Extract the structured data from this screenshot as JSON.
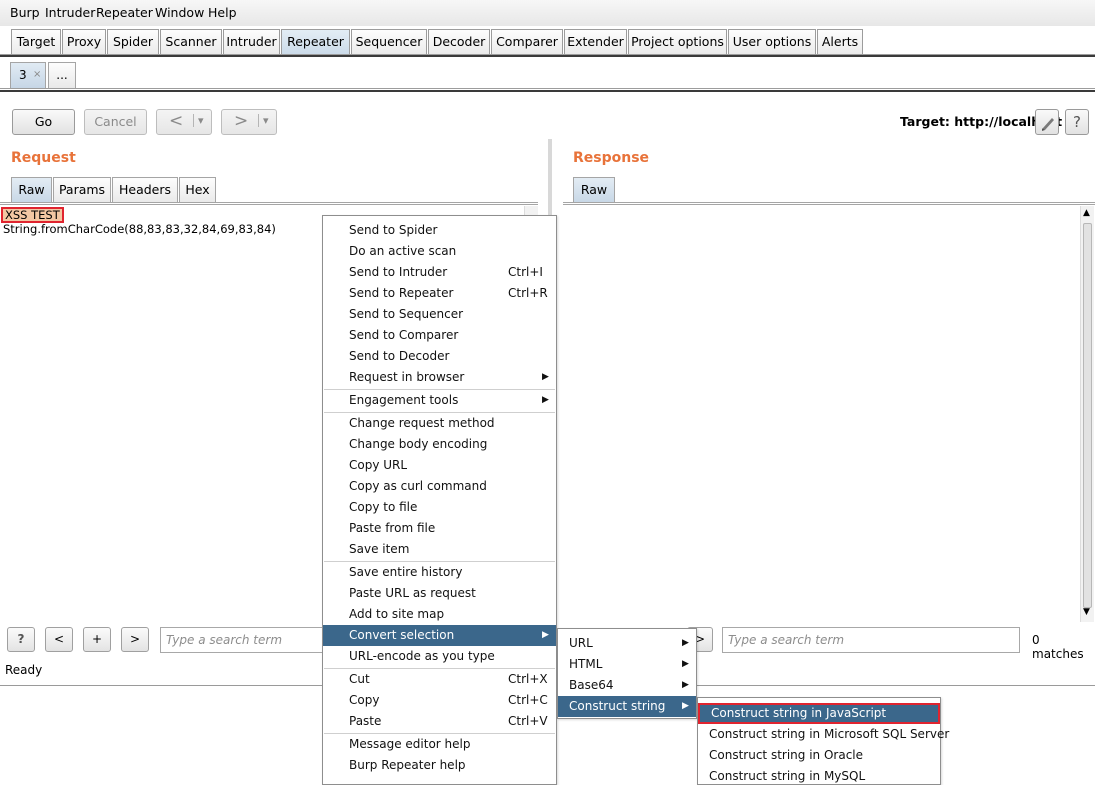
{
  "menubar": [
    "Burp",
    "Intruder",
    "Repeater",
    "Window",
    "Help"
  ],
  "tabs": [
    "Target",
    "Proxy",
    "Spider",
    "Scanner",
    "Intruder",
    "Repeater",
    "Sequencer",
    "Decoder",
    "Comparer",
    "Extender",
    "Project options",
    "User options",
    "Alerts"
  ],
  "active_tab": "Repeater",
  "subtabs": [
    "3",
    "..."
  ],
  "subtab_close": "×",
  "toolbar": {
    "go": "Go",
    "cancel": "Cancel",
    "back": "<",
    "forward": ">",
    "dropdown": "▾",
    "target_label": "Target: http://localhost"
  },
  "request": {
    "title": "Request",
    "tabs": [
      "Raw",
      "Params",
      "Headers",
      "Hex"
    ],
    "lines": [
      "XSS TEST",
      "String.fromCharCode(88,83,83,32,84,69,83,84)"
    ]
  },
  "response": {
    "title": "Response",
    "tabs": [
      "Raw"
    ]
  },
  "bottom": {
    "help": "?",
    "prev": "<",
    "add": "+",
    "next": ">",
    "search_placeholder": "Type a search term",
    "matches": "0 matches"
  },
  "status": "Ready",
  "context_menu": {
    "groups": [
      [
        {
          "label": "Send to Spider"
        },
        {
          "label": "Do an active scan"
        },
        {
          "label": "Send to Intruder",
          "shortcut": "Ctrl+I"
        },
        {
          "label": "Send to Repeater",
          "shortcut": "Ctrl+R"
        },
        {
          "label": "Send to Sequencer"
        },
        {
          "label": "Send to Comparer"
        },
        {
          "label": "Send to Decoder"
        },
        {
          "label": "Request in browser",
          "submenu": true
        }
      ],
      [
        {
          "label": "Engagement tools",
          "submenu": true
        }
      ],
      [
        {
          "label": "Change request method"
        },
        {
          "label": "Change body encoding"
        },
        {
          "label": "Copy URL"
        },
        {
          "label": "Copy as curl command"
        },
        {
          "label": "Copy to file"
        },
        {
          "label": "Paste from file"
        },
        {
          "label": "Save item"
        }
      ],
      [
        {
          "label": "Save entire history"
        },
        {
          "label": "Paste URL as request"
        },
        {
          "label": "Add to site map"
        },
        {
          "label": "Convert selection",
          "submenu": true,
          "highlighted": true
        },
        {
          "label": "URL-encode as you type"
        }
      ],
      [
        {
          "label": "Cut",
          "shortcut": "Ctrl+X"
        },
        {
          "label": "Copy",
          "shortcut": "Ctrl+C"
        },
        {
          "label": "Paste",
          "shortcut": "Ctrl+V"
        }
      ],
      [
        {
          "label": "Message editor help"
        },
        {
          "label": "Burp Repeater help"
        }
      ]
    ]
  },
  "convert_submenu": [
    {
      "label": "URL"
    },
    {
      "label": "HTML"
    },
    {
      "label": "Base64"
    },
    {
      "label": "Construct string",
      "highlighted": true
    }
  ],
  "construct_submenu": [
    {
      "label": "Construct string in JavaScript",
      "highlighted": true
    },
    {
      "label": "Construct string in Microsoft SQL Server"
    },
    {
      "label": "Construct string in Oracle"
    },
    {
      "label": "Construct string in MySQL"
    }
  ],
  "colors": {
    "accent_orange": "#e8733a",
    "menu_highlight": "#3b678b",
    "selection_box": "#e0242f",
    "selection_fill": "#f3c7a3"
  }
}
